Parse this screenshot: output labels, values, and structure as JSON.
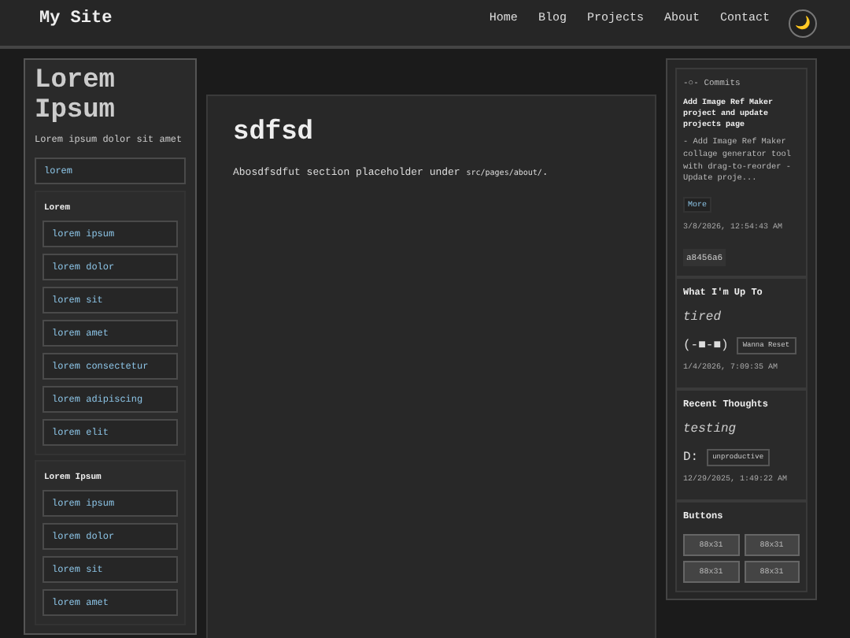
{
  "header": {
    "site_title": "My Site",
    "nav": [
      {
        "label": "Home"
      },
      {
        "label": "Blog"
      },
      {
        "label": "Projects"
      },
      {
        "label": "About"
      },
      {
        "label": "Contact"
      }
    ],
    "theme_toggle": "🌙"
  },
  "left_sidebar": {
    "title": "Lorem Ipsum",
    "subtitle": "Lorem ipsum dolor sit amet",
    "top_link": "lorem",
    "groups": [
      {
        "heading": "Lorem",
        "links": [
          "lorem ipsum",
          "lorem dolor",
          "lorem sit",
          "lorem amet",
          "lorem consectetur",
          "lorem adipiscing",
          "lorem elit"
        ]
      },
      {
        "heading": "Lorem Ipsum",
        "links": [
          "lorem ipsum",
          "lorem dolor",
          "lorem sit",
          "lorem amet"
        ]
      }
    ]
  },
  "main": {
    "heading": "sdfsd",
    "text": "Abosdfsdfut section placeholder under",
    "code": "src/pages/about/",
    "end": "."
  },
  "right_sidebar": {
    "commits": {
      "label": "-○- Commits",
      "title": "Add Image Ref Maker project and update projects page",
      "body": "- Add Image Ref Maker collage generator tool with drag-to-reorder - Update proje...",
      "more": "More",
      "date": "3/8/2026, 12:54:43 AM",
      "hash": "a8456a6"
    },
    "status_cards": [
      {
        "heading": "What I'm Up To",
        "status": "tired",
        "face": "(-■-■)",
        "tag": "Wanna Reset",
        "date": "1/4/2026, 7:09:35 AM"
      },
      {
        "heading": "Recent Thoughts",
        "status": "testing",
        "face": "D:",
        "tag": "unproductive",
        "date": "12/29/2025, 1:49:22 AM"
      }
    ],
    "buttons": {
      "heading": "Buttons",
      "items": [
        "88x31",
        "88x31",
        "88x31",
        "88x31"
      ]
    }
  }
}
